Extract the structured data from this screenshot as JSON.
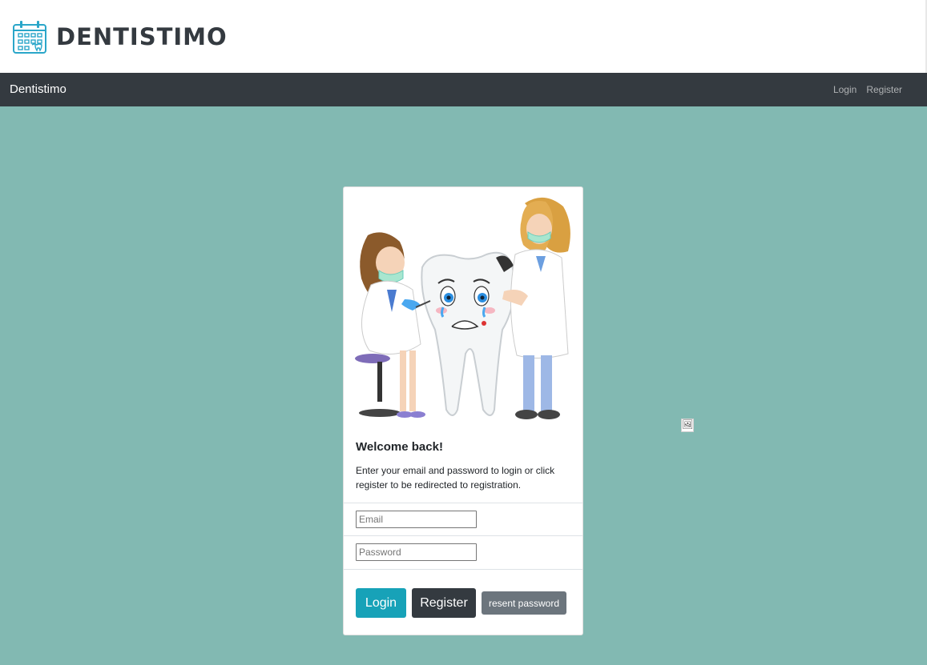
{
  "header": {
    "logo_text": "DENTISTIMO",
    "logo_icon": "calendar-tooth-icon"
  },
  "navbar": {
    "brand": "Dentistimo",
    "links": [
      {
        "label": "Login"
      },
      {
        "label": "Register"
      }
    ]
  },
  "card": {
    "illustration": "dentists-with-crying-tooth-illustration",
    "title": "Welcome back!",
    "text": "Enter your email and password to login or click register to be redirected to registration.",
    "email": {
      "placeholder": "Email",
      "value": ""
    },
    "password": {
      "placeholder": "Password",
      "value": ""
    },
    "buttons": {
      "login": "Login",
      "register": "Register",
      "reset": "resent password"
    }
  },
  "colors": {
    "background": "#82b9b2",
    "navbar": "#343a40",
    "login_button": "#17a2b8",
    "register_button": "#343a40",
    "reset_button": "#6c757d"
  },
  "broken_image": {
    "icon": "broken-image-icon"
  }
}
